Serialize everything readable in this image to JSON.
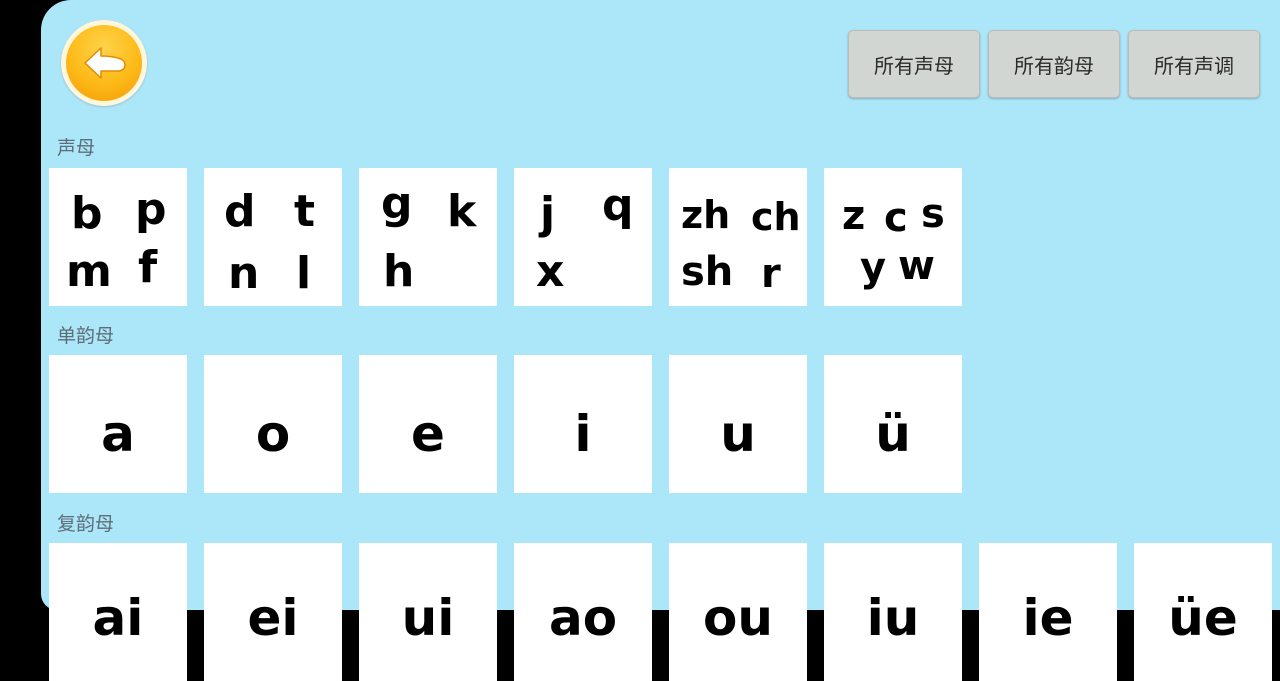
{
  "header": {
    "back_icon": "back-arrow-icon",
    "buttons": [
      "所有声母",
      "所有韵母",
      "所有声调"
    ]
  },
  "colors": {
    "background": "#ACE6F9",
    "card": "#FFFFFF",
    "button": "#D2D6D2",
    "back_button": "#FDBA18"
  },
  "sections": {
    "initials": {
      "label": "声母",
      "cards": [
        [
          "b",
          "p",
          "m",
          "f"
        ],
        [
          "d",
          "t",
          "n",
          "l"
        ],
        [
          "g",
          "k",
          "h"
        ],
        [
          "j",
          "q",
          "x"
        ],
        [
          "zh",
          "ch",
          "sh",
          "r"
        ],
        [
          "z",
          "c",
          "s",
          "y",
          "w"
        ]
      ]
    },
    "simple_finals": {
      "label": "单韵母",
      "cards": [
        "a",
        "o",
        "e",
        "i",
        "u",
        "ü"
      ]
    },
    "compound_finals": {
      "label": "复韵母",
      "cards": [
        "ai",
        "ei",
        "ui",
        "ao",
        "ou",
        "iu",
        "ie",
        "üe"
      ]
    }
  }
}
